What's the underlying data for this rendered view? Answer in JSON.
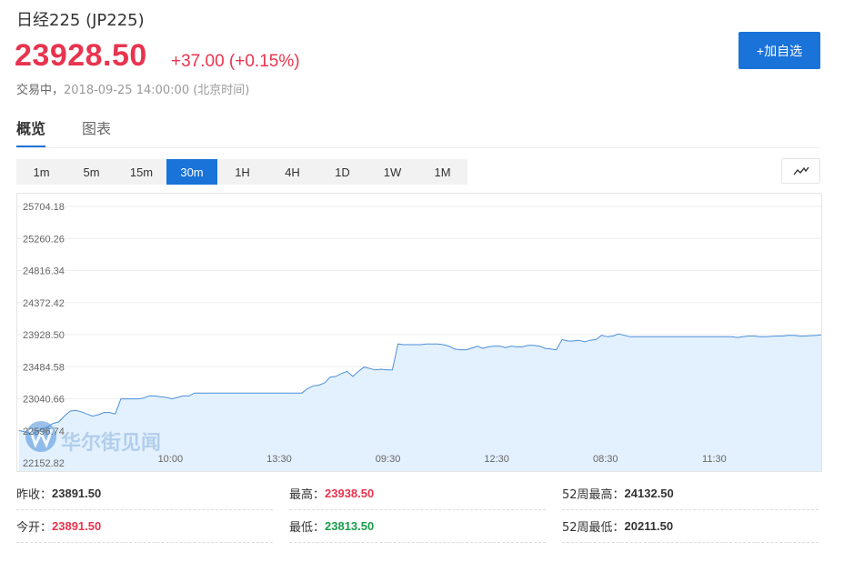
{
  "header": {
    "title": "日经225",
    "code": "(JP225)",
    "price": "23928.50",
    "change": "+37.00 (+0.15%)",
    "status_label": "交易中，",
    "status_time": "2018-09-25 14:00:00 (北京时间)",
    "add_button": "+加自选"
  },
  "tabs": [
    {
      "label": "概览",
      "active": true
    },
    {
      "label": "图表",
      "active": false
    }
  ],
  "intervals": [
    "1m",
    "5m",
    "15m",
    "30m",
    "1H",
    "4H",
    "1D",
    "1W",
    "1M"
  ],
  "active_interval": "30m",
  "chart_type_icon": "line-chart-icon",
  "watermark": "华尔街见闻",
  "colors": {
    "accent": "#1a73d9",
    "up": "#e8344e",
    "down": "#1a9c4b",
    "line": "#4a90d9",
    "area": "#e3f0fd"
  },
  "chart_data": {
    "type": "area",
    "y_ticks": [
      "25704.18",
      "25260.26",
      "24816.34",
      "24372.42",
      "23928.50",
      "23484.58",
      "23040.66",
      "22596.74",
      "22152.82"
    ],
    "ylim": [
      22152.82,
      25704.18
    ],
    "x_ticks": [
      "10:00",
      "13:30",
      "09:30",
      "12:30",
      "08:30",
      "11:30"
    ],
    "y": [
      22600,
      22585,
      22560,
      22580,
      22620,
      22650,
      22700,
      22720,
      22800,
      22870,
      22880,
      22860,
      22830,
      22800,
      22820,
      22850,
      22850,
      22830,
      23040,
      23040,
      23040,
      23040,
      23050,
      23080,
      23080,
      23070,
      23060,
      23040,
      23060,
      23080,
      23080,
      23120,
      23120,
      23120,
      23120,
      23120,
      23120,
      23120,
      23120,
      23120,
      23120,
      23120,
      23120,
      23120,
      23120,
      23120,
      23120,
      23120,
      23120,
      23120,
      23120,
      23180,
      23220,
      23230,
      23260,
      23340,
      23350,
      23390,
      23420,
      23350,
      23420,
      23480,
      23460,
      23440,
      23450,
      23440,
      23440,
      23800,
      23790,
      23790,
      23790,
      23790,
      23800,
      23800,
      23800,
      23790,
      23770,
      23730,
      23720,
      23720,
      23740,
      23770,
      23740,
      23760,
      23770,
      23770,
      23750,
      23770,
      23760,
      23760,
      23780,
      23780,
      23770,
      23740,
      23730,
      23720,
      23860,
      23840,
      23840,
      23850,
      23830,
      23850,
      23860,
      23920,
      23900,
      23910,
      23940,
      23920,
      23900,
      23900,
      23900,
      23900,
      23900,
      23900,
      23900,
      23900,
      23900,
      23900,
      23900,
      23900,
      23900,
      23900,
      23900,
      23900,
      23900,
      23900,
      23900,
      23890,
      23900,
      23910,
      23910,
      23900,
      23900,
      23905,
      23910,
      23910,
      23920,
      23920,
      23910,
      23910,
      23915,
      23920,
      23928.5
    ]
  },
  "stats": [
    [
      {
        "label": "昨收：",
        "value": "23891.50",
        "tone": "neutral"
      },
      {
        "label": "最高：",
        "value": "23938.50",
        "tone": "red"
      },
      {
        "label": "52周最高：",
        "value": "24132.50",
        "tone": "neutral"
      }
    ],
    [
      {
        "label": "今开：",
        "value": "23891.50",
        "tone": "red"
      },
      {
        "label": "最低：",
        "value": "23813.50",
        "tone": "green"
      },
      {
        "label": "52周最低：",
        "value": "20211.50",
        "tone": "neutral"
      }
    ]
  ]
}
